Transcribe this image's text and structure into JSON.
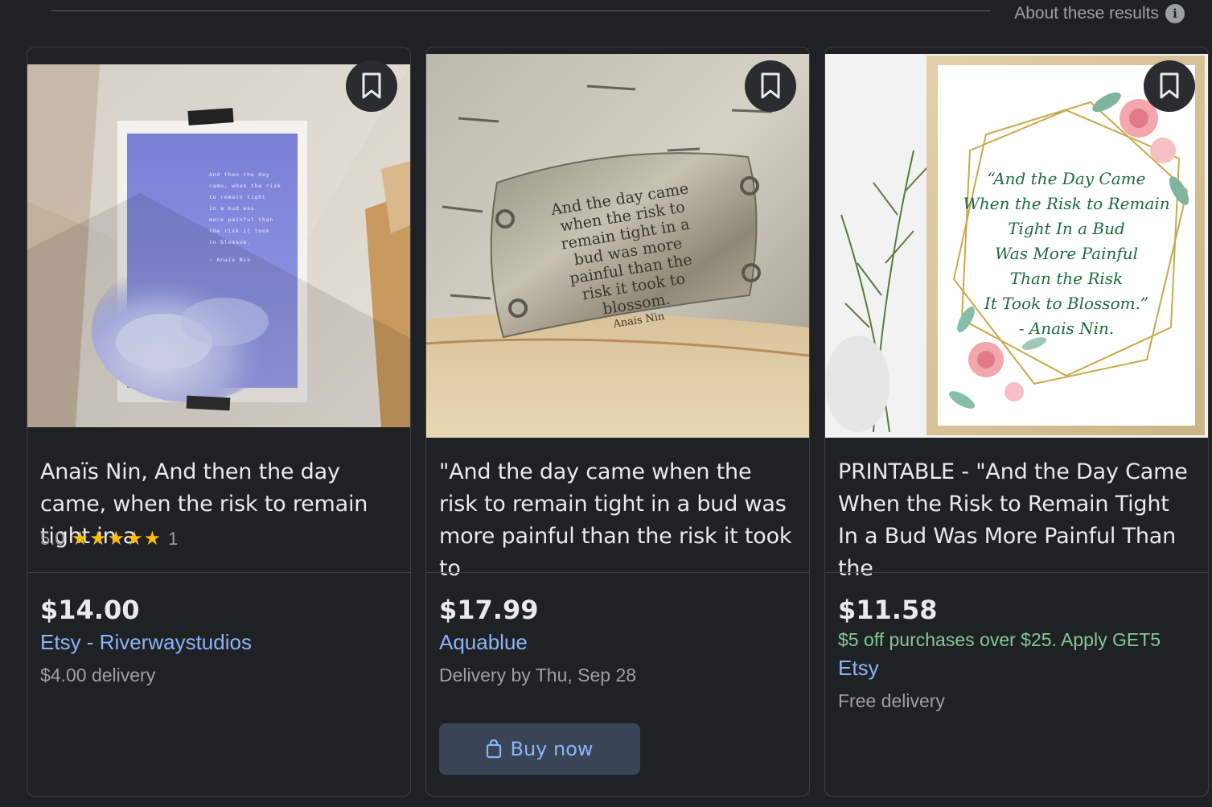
{
  "header": {
    "about_label": "About these results",
    "info_icon_glyph": "i"
  },
  "products": [
    {
      "title": "Anaïs Nin, And then the day came, when the risk to remain tight in a",
      "rating": "5.0",
      "stars": "★★★★★",
      "review_count": "1",
      "price": "$14.00",
      "seller": "Etsy - Riverwaystudios",
      "delivery": "$4.00 delivery",
      "image_icon": "purple-poster-image"
    },
    {
      "title": "\"And the day came when the risk to remain tight in a bud was more painful than the risk it took to",
      "price": "$17.99",
      "seller": "Aquablue",
      "delivery": "Delivery by Thu, Sep 28",
      "buy_label": "Buy now",
      "image_icon": "metal-plaque-image",
      "plaque_lines": [
        "And the day came",
        "when the risk to",
        "remain tight in a",
        "bud was more",
        "painful than the",
        "risk it took to",
        "blossom.",
        "Anais Nin"
      ]
    },
    {
      "title": "PRINTABLE - \"And the Day Came When the Risk to Remain Tight In a Bud Was More Painful Than the",
      "price": "$11.58",
      "promo": "$5 off purchases over $25. Apply GET5",
      "seller": "Etsy",
      "delivery": "Free delivery",
      "image_icon": "floral-print-image",
      "print_lines": [
        "“And the Day Came",
        "When the Risk to Remain",
        "Tight In a Bud",
        "Was More Painful",
        "Than the Risk",
        "It Took to Blossom.”",
        "- Anais Nin."
      ]
    }
  ],
  "poster_lines": [
    "And then the day",
    "came, when the risk",
    "to remain tight",
    "in a bud was",
    "more painful than",
    "the risk it took",
    "to blossom.",
    "- Anaïs Nin"
  ],
  "colors": {
    "background": "#202124",
    "link": "#8ab4f8",
    "promo": "#81c995",
    "star": "#fbbc04"
  }
}
